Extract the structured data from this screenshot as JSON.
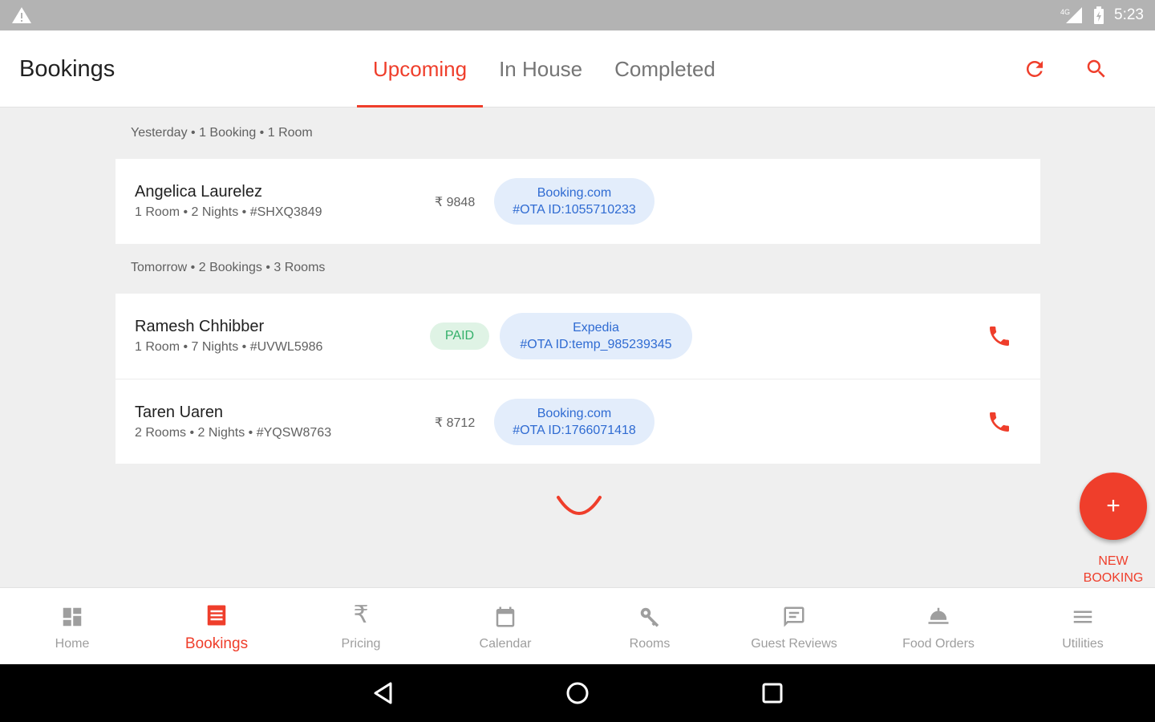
{
  "status_bar": {
    "time": "5:23",
    "network": "4G"
  },
  "app_bar": {
    "title": "Bookings",
    "tabs": [
      {
        "label": "Upcoming",
        "active": true
      },
      {
        "label": "In House",
        "active": false
      },
      {
        "label": "Completed",
        "active": false
      }
    ],
    "icons": [
      "refresh-icon",
      "search-icon"
    ]
  },
  "groups": [
    {
      "header": "Yesterday • 1 Booking • 1 Room",
      "bookings": [
        {
          "name": "Angelica Laurelez",
          "meta": "1 Room • 2 Nights • #SHXQ3849",
          "amount": "₹ 9848",
          "paid": null,
          "ota_source": "Booking.com",
          "ota_id": "#OTA ID:1055710233",
          "phone": false
        }
      ]
    },
    {
      "header": "Tomorrow • 2 Bookings • 3 Rooms",
      "bookings": [
        {
          "name": "Ramesh Chhibber",
          "meta": "1 Room • 7 Nights • #UVWL5986",
          "amount": null,
          "paid": "PAID",
          "ota_source": "Expedia",
          "ota_id": "#OTA ID:temp_985239345",
          "phone": true
        },
        {
          "name": "Taren Uaren",
          "meta": "2 Rooms • 2 Nights • #YQSW8763",
          "amount": "₹ 8712",
          "paid": null,
          "ota_source": "Booking.com",
          "ota_id": "#OTA ID:1766071418",
          "phone": true
        }
      ]
    }
  ],
  "fab": {
    "icon": "+",
    "label_line1": "NEW",
    "label_line2": "BOOKING"
  },
  "bottom_nav": [
    {
      "label": "Home",
      "icon": "dashboard-icon",
      "active": false
    },
    {
      "label": "Bookings",
      "icon": "bookings-icon",
      "active": true
    },
    {
      "label": "Pricing",
      "icon": "rupee-icon",
      "active": false
    },
    {
      "label": "Calendar",
      "icon": "calendar-icon",
      "active": false
    },
    {
      "label": "Rooms",
      "icon": "key-icon",
      "active": false
    },
    {
      "label": "Guest Reviews",
      "icon": "reviews-icon",
      "active": false
    },
    {
      "label": "Food Orders",
      "icon": "food-icon",
      "active": false
    },
    {
      "label": "Utilities",
      "icon": "menu-icon",
      "active": false
    }
  ],
  "colors": {
    "accent": "#ef3e2b",
    "ota_text": "#2f6bd2",
    "ota_bg": "#e3edfb",
    "paid_text": "#34b06a",
    "paid_bg": "#dff3e5"
  }
}
